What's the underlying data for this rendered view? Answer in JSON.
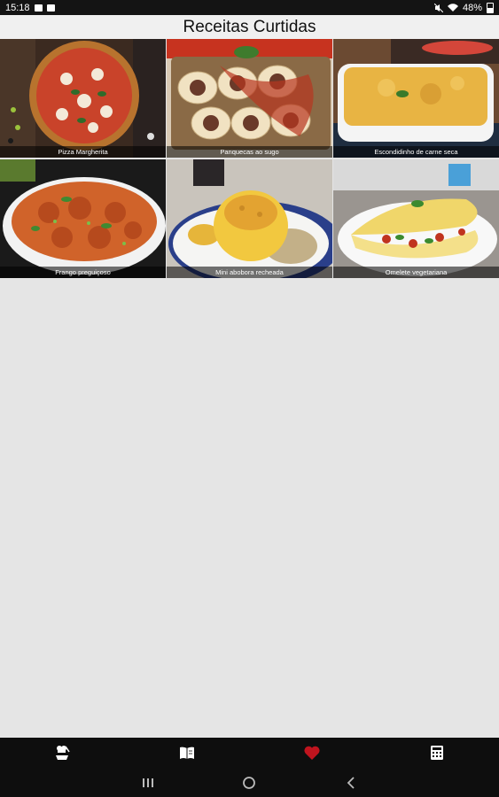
{
  "status": {
    "time": "15:18",
    "battery": "48%",
    "icons": [
      "gallery-icon",
      "notification-app-icon",
      "mute-icon",
      "wifi-icon",
      "battery-icon"
    ]
  },
  "header": {
    "title": "Receitas Curtidas"
  },
  "recipes": [
    {
      "name": "Pizza Margherita"
    },
    {
      "name": "Panquecas ao sugo"
    },
    {
      "name": "Escondidinho de carne seca"
    },
    {
      "name": "Frango preguiçoso"
    },
    {
      "name": "Mini abobora recheada"
    },
    {
      "name": "Omelete vegetariana"
    }
  ],
  "bottom_nav": {
    "items": [
      {
        "icon": "chef-icon",
        "active": false
      },
      {
        "icon": "recipe-book-icon",
        "active": false
      },
      {
        "icon": "heart-icon",
        "active": true
      },
      {
        "icon": "calculator-icon",
        "active": false
      }
    ],
    "active_color": "#c0141e",
    "inactive_color": "#ffffff"
  },
  "system_nav": {
    "icons": [
      "recents-icon",
      "home-icon",
      "back-icon"
    ]
  }
}
